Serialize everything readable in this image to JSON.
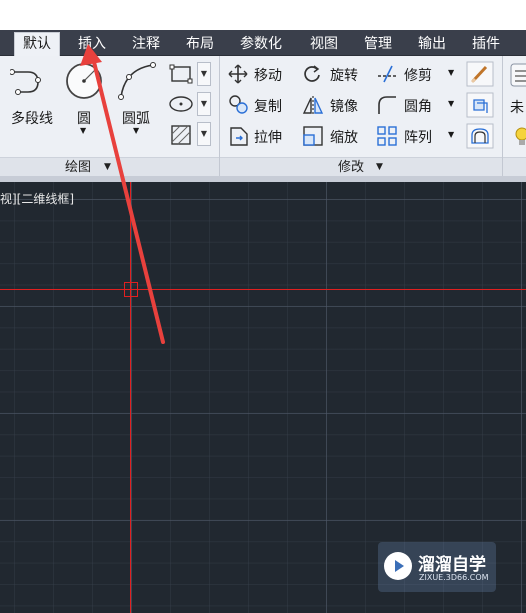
{
  "tabs": [
    {
      "label": "默认",
      "active": true
    },
    {
      "label": "插入"
    },
    {
      "label": "注释"
    },
    {
      "label": "布局"
    },
    {
      "label": "参数化"
    },
    {
      "label": "视图"
    },
    {
      "label": "管理"
    },
    {
      "label": "输出"
    },
    {
      "label": "插件"
    }
  ],
  "draw_panel": {
    "polyline_label": "多段线",
    "circle_label": "圆",
    "arc_label": "圆弧",
    "footer_label": "绘图",
    "footer_arrow": "▼"
  },
  "modify_panel": {
    "move": "移动",
    "rotate": "旋转",
    "trim": "修剪",
    "copy": "复制",
    "mirror": "镜像",
    "fillet": "圆角",
    "stretch": "拉伸",
    "scale": "缩放",
    "array": "阵列",
    "footer_label": "修改",
    "footer_arrow": "▼"
  },
  "layers_panel": {
    "partial_label": "未"
  },
  "viewport": {
    "label": "视][二维线框]"
  },
  "watermark": {
    "title": "溜溜自学",
    "subtitle": "ZIXUE.3D66.COM"
  },
  "colors": {
    "canvas": "#212830",
    "crosshair": "#e02020",
    "arrow": "#e8413d",
    "tabbar": "#3a3f4b"
  },
  "icons": [
    "polyline-icon",
    "circle-icon",
    "arc-icon",
    "rectangle-icon",
    "ellipse-icon",
    "hatch-icon",
    "move-icon",
    "rotate-icon",
    "trim-icon",
    "copy-icon",
    "mirror-icon",
    "fillet-icon",
    "stretch-icon",
    "scale-icon",
    "array-icon",
    "eraser-icon",
    "explode-icon",
    "offset-icon",
    "layer-icon",
    "bulb-icon"
  ]
}
